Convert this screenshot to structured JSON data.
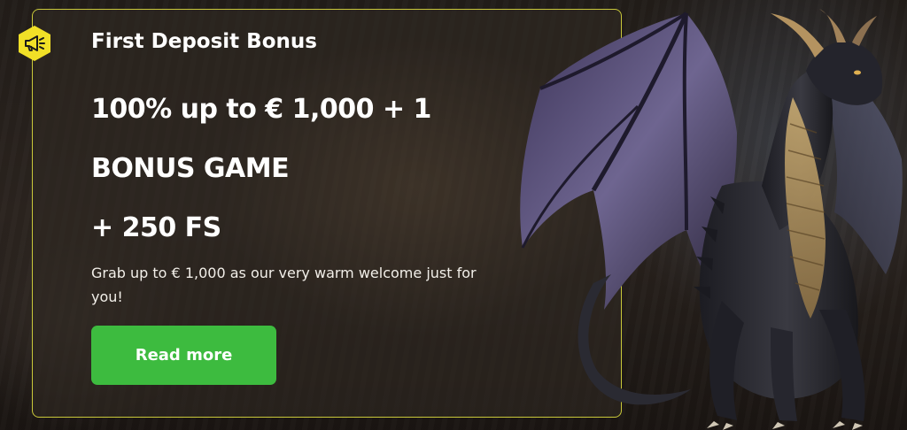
{
  "promo": {
    "title": "First Deposit Bonus",
    "headline_line1": "100% up to € 1,000 + 1",
    "headline_line2": "BONUS GAME",
    "headline_line3": "+ 250 FS",
    "description": "Grab up to € 1,000 as our very warm welcome just for you!",
    "cta_label": "Read more"
  },
  "icons": {
    "badge": "megaphone-icon",
    "illustration": "dragon-illustration"
  },
  "colors": {
    "card_border": "#c9c83a",
    "badge_fill": "#f1e027",
    "cta_background": "#3dbb3f",
    "text": "#ffffff"
  }
}
